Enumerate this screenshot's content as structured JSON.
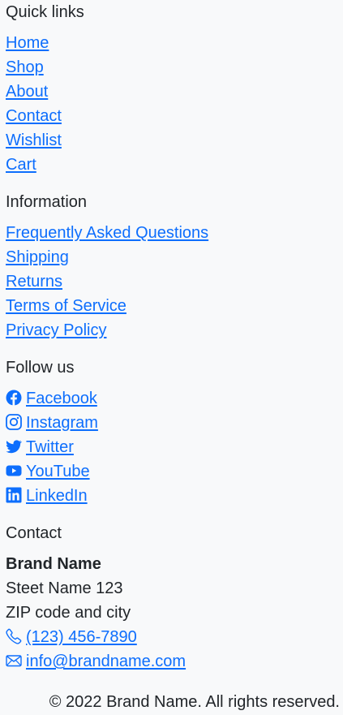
{
  "quick_links": {
    "heading": "Quick links",
    "items": [
      "Home",
      "Shop",
      "About",
      "Contact",
      "Wishlist",
      "Cart"
    ]
  },
  "information": {
    "heading": "Information",
    "items": [
      "Frequently Asked Questions",
      "Shipping",
      "Returns",
      "Terms of Service",
      "Privacy Policy"
    ]
  },
  "follow_us": {
    "heading": "Follow us",
    "items": [
      {
        "label": "Facebook",
        "icon": "facebook-icon"
      },
      {
        "label": "Instagram",
        "icon": "instagram-icon"
      },
      {
        "label": "Twitter",
        "icon": "twitter-icon"
      },
      {
        "label": "YouTube",
        "icon": "youtube-icon"
      },
      {
        "label": "LinkedIn",
        "icon": "linkedin-icon"
      }
    ]
  },
  "contact": {
    "heading": "Contact",
    "brand": "Brand Name",
    "street": "Steet Name 123",
    "city": "ZIP code and city",
    "phone": {
      "label": "(123) 456-7890",
      "icon": "phone-icon"
    },
    "email": {
      "label": "info@brandname.com",
      "icon": "envelope-icon"
    }
  },
  "copyright": "© 2022 Brand Name. All rights reserved.",
  "colors": {
    "link": "#0d6efd",
    "text": "#212529",
    "background": "#f8f9fa"
  }
}
